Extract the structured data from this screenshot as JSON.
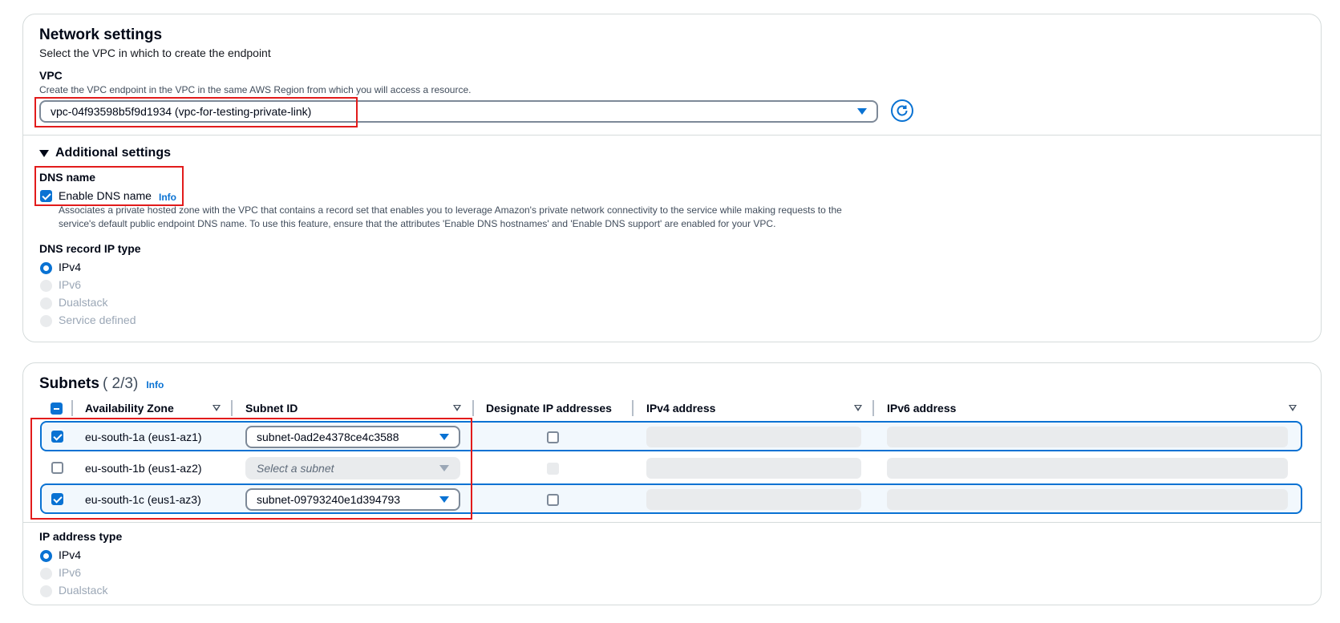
{
  "network": {
    "title": "Network settings",
    "subtitle": "Select the VPC in which to create the endpoint",
    "vpc_label": "VPC",
    "vpc_description": "Create the VPC endpoint in the VPC in the same AWS Region from which you will access a resource.",
    "vpc_value": "vpc-04f93598b5f9d1934 (vpc-for-testing-private-link)",
    "additional_settings": "Additional settings",
    "dns_name_label": "DNS name",
    "enable_dns_label": "Enable DNS name",
    "enable_dns_checked": true,
    "info": "Info",
    "dns_description_line1": "Associates a private hosted zone with the VPC that contains a record set that enables you to leverage Amazon's private network connectivity to the service while making requests to the",
    "dns_description_line2": "service's default public endpoint DNS name. To use this feature, ensure that the attributes 'Enable DNS hostnames' and 'Enable DNS support' are enabled for your VPC.",
    "dns_record_label": "DNS record IP type",
    "dns_record_options": [
      "IPv4",
      "IPv6",
      "Dualstack",
      "Service defined"
    ],
    "dns_record_selected": "IPv4"
  },
  "subnets": {
    "title": "Subnets",
    "count": "( 2/3)",
    "info": "Info",
    "columns": [
      "Availability Zone",
      "Subnet ID",
      "Designate IP addresses",
      "IPv4 address",
      "IPv6 address"
    ],
    "rows": [
      {
        "zone": "eu-south-1a (eus1-az1)",
        "subnet": "subnet-0ad2e4378ce4c3588",
        "selected": true
      },
      {
        "zone": "eu-south-1b (eus1-az2)",
        "subnet": "Select a subnet",
        "selected": false
      },
      {
        "zone": "eu-south-1c (eus1-az3)",
        "subnet": "subnet-09793240e1d394793",
        "selected": true
      }
    ],
    "ip_type_label": "IP address type",
    "ip_type_options": [
      "IPv4",
      "IPv6",
      "Dualstack"
    ],
    "ip_type_selected": "IPv4"
  },
  "colors": {
    "accent": "#0972d3",
    "highlight": "#e21b1b",
    "selected_row_bg": "#f2f8fd"
  }
}
